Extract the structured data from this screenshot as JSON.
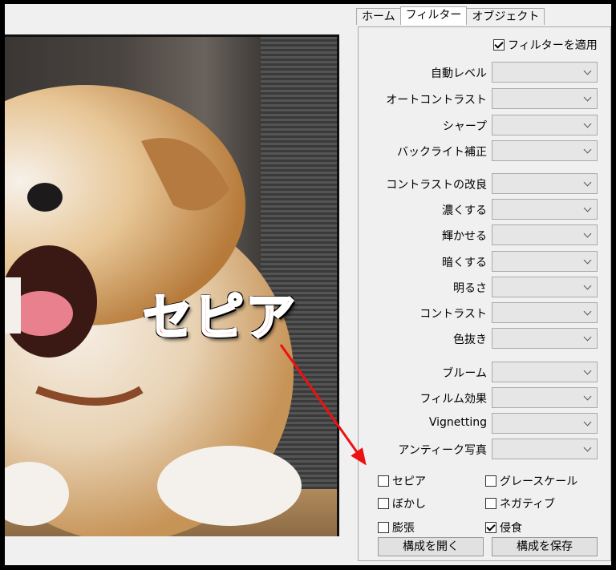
{
  "tabs": [
    "ホーム",
    "フィルター",
    "オブジェクト"
  ],
  "apply_filter": {
    "label": "フィルターを適用",
    "checked": true
  },
  "dropdowns": [
    {
      "label": "自動レベル"
    },
    {
      "label": "オートコントラスト"
    },
    {
      "label": "シャープ"
    },
    {
      "label": "バックライト補正"
    },
    {
      "label": "コントラストの改良"
    },
    {
      "label": "濃くする"
    },
    {
      "label": "輝かせる"
    },
    {
      "label": "暗くする"
    },
    {
      "label": "明るさ"
    },
    {
      "label": "コントラスト"
    },
    {
      "label": "色抜き"
    },
    {
      "label": "ブルーム"
    },
    {
      "label": "フィルム効果"
    },
    {
      "label": "Vignetting"
    },
    {
      "label": "アンティーク写真"
    }
  ],
  "checkboxes": [
    {
      "label": "セピア",
      "checked": false
    },
    {
      "label": "グレースケール",
      "checked": false
    },
    {
      "label": "ぼかし",
      "checked": false
    },
    {
      "label": "ネガティブ",
      "checked": false
    },
    {
      "label": "膨張",
      "checked": false
    },
    {
      "label": "侵食",
      "checked": true
    }
  ],
  "buttons": {
    "open": "構成を開く",
    "save": "構成を保存"
  },
  "annotation": {
    "text": "セピア",
    "color": "#ff1a1a"
  },
  "icons": [
    "chevron-down-icon",
    "checkbox-icon",
    "arrow-icon"
  ]
}
